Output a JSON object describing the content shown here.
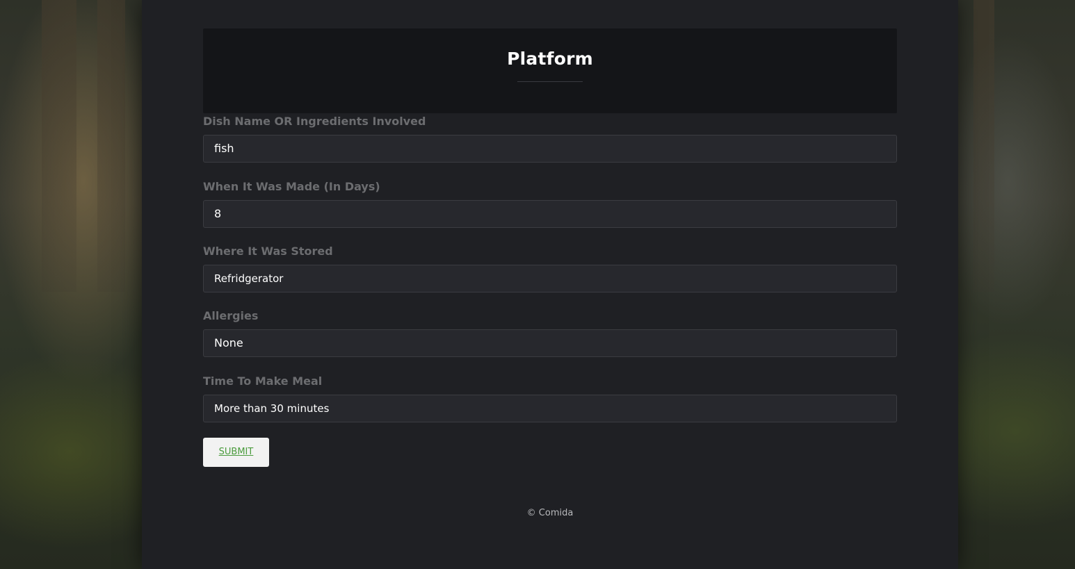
{
  "header": {
    "title": "Platform"
  },
  "form": {
    "fields": [
      {
        "label": "Dish Name OR Ingredients Involved",
        "value": "fish"
      },
      {
        "label": "When It Was Made (In Days)",
        "value": "8"
      },
      {
        "label": "Where It Was Stored",
        "value": "Refridgerator"
      },
      {
        "label": "Allergies",
        "value": "None"
      },
      {
        "label": "Time To Make Meal",
        "value": "More than 30 minutes"
      }
    ],
    "submit_label": "SUBMIT"
  },
  "footer": {
    "text": "© Comida"
  },
  "colors": {
    "panel": "#1f2024",
    "header": "#141518",
    "input": "#27282d",
    "label": "#6c6d70",
    "submit_text": "#4a9b3c"
  }
}
